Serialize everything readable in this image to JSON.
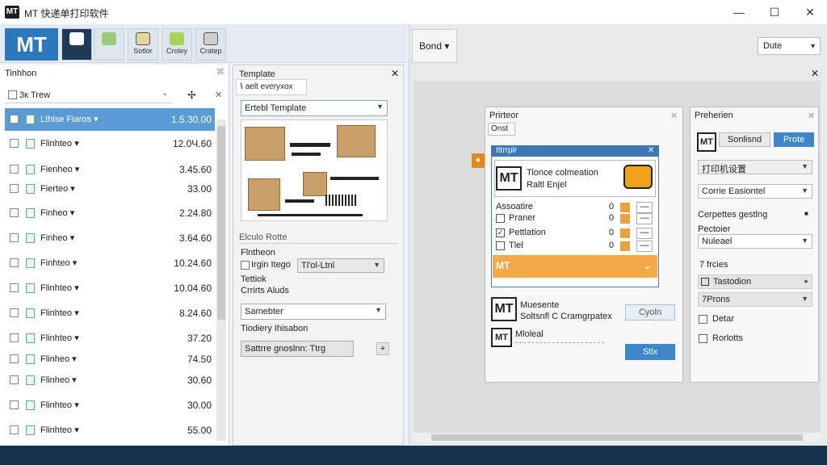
{
  "titlebar": {
    "logo_text": "MT",
    "title": "MT 快递单打印软件",
    "minimize": "—",
    "maximize": "☐",
    "close": "✕"
  },
  "ribbon": {
    "logo_text": "MT",
    "buttons": [
      {
        "label": "",
        "icon": "database-icon"
      },
      {
        "label": "",
        "icon": "arrow-tree-icon"
      },
      {
        "label": "Sotlor",
        "icon": "document-edit-icon"
      },
      {
        "label": "Croley",
        "icon": "down-arrow-icon"
      },
      {
        "label": "Cratep",
        "icon": "cloud-edit-icon"
      }
    ]
  },
  "list_panel": {
    "title": "Tinhhon",
    "pin": "⌘",
    "filter_label": "3к Trew",
    "filter_arrow": "⌄",
    "fan_icon": "✢",
    "close": "✕",
    "rows": [
      {
        "label": "Lthlse Fiaros ▾",
        "value": "1.5.30.00",
        "selected": true
      },
      {
        "label": "Flinhteo ▾",
        "value": "12.0Ч.60",
        "selected": false
      },
      {
        "label": "Fienheo ▾",
        "value": "3.45.60",
        "selected": false
      },
      {
        "label": "Fierteo ▾",
        "value": "33.00",
        "selected": false
      },
      {
        "label": "Finheo ▾",
        "value": "2.24.80",
        "selected": false
      },
      {
        "label": "Finheo ▾",
        "value": "3.64.60",
        "selected": false
      },
      {
        "label": "Finhteo ▾",
        "value": "10.24.60",
        "selected": false
      },
      {
        "label": "Flinhteo ▾",
        "value": "10.04.60",
        "selected": false
      },
      {
        "label": "Flinhteo ▾",
        "value": "8.24.60",
        "selected": false
      },
      {
        "label": "Flinhteo ▾",
        "value": "37.20",
        "selected": false
      },
      {
        "label": "Flinheo ▾",
        "value": "74.50",
        "selected": false
      },
      {
        "label": "Flinheo ▾",
        "value": "30.60",
        "selected": false
      },
      {
        "label": "Flinhteo ▾",
        "value": "30.00",
        "selected": false
      },
      {
        "label": "Flinhteo ▾",
        "value": "55.00",
        "selected": false
      }
    ]
  },
  "template_panel": {
    "title": "Template",
    "close": "✕",
    "tab": "ꝇ aelt everyxox",
    "select": "Ertebl Template",
    "section1": "Elculo Rotte",
    "label1": "Flntheon",
    "label2": "Irgin Itego",
    "dropdown1": "Tl'ol-Ltnl",
    "label3": "Tettiok",
    "label4": "Crrirts Aluds",
    "dropdown2": "Samebter",
    "label5": "Tiodiery Ihisabon",
    "dropdown3": "Sattrre gnoslnn: Ttrg",
    "plus": "+"
  },
  "right_area": {
    "head_label": "Bond ▾",
    "dropdown": "Dute",
    "close": "✕"
  },
  "printer_dialog": {
    "title": "Prirteor",
    "close": "✕",
    "tab": "Onst",
    "badge": "●",
    "sub_title": "Ittrrplr",
    "sub_close": "✕",
    "card_logo": "MT",
    "card_line1": "Tionce colmeation",
    "card_line2": "Raltl Enjel",
    "options": [
      {
        "label": "Assoatire",
        "num": "0",
        "checked": false,
        "cb": false
      },
      {
        "label": "Praner",
        "num": "0",
        "checked": false,
        "cb": true
      },
      {
        "label": "Pettlation",
        "num": "0",
        "checked": true,
        "cb": true
      },
      {
        "label": "Tlel",
        "num": "0",
        "checked": false,
        "cb": true
      }
    ],
    "bar_logo": "MT",
    "bar_chevron": "⌄",
    "card2_logo": "MT",
    "card2_line1": "Muesente",
    "card2_line2": "Soltsnfl C Cramgrpatex",
    "card2_button": "Cyoln",
    "card3_logo": "MT",
    "card3_line1": "Mloleal",
    "card3_button": "Stlx"
  },
  "properties": {
    "title": "Preherien",
    "close": "✕",
    "logo": "MT",
    "sub_button": "Sonlisnd",
    "primary_button": "Prote",
    "dropdown1": "打印机设置",
    "dropdown2": "Corrie Easiontel",
    "label3": "Cerpettes gestlng",
    "label4": "Pectoier",
    "dropdown4": "Nuleael",
    "label5": "7 frcies",
    "row1": "Tastodion",
    "row2": "7Prons",
    "cb1": "Detar",
    "cb2": "Rorlotts"
  },
  "colors": {
    "accent": "#3f86c8",
    "selection": "#5b9bd5",
    "orange": "#f3a947",
    "taskbar": "#17324a"
  }
}
